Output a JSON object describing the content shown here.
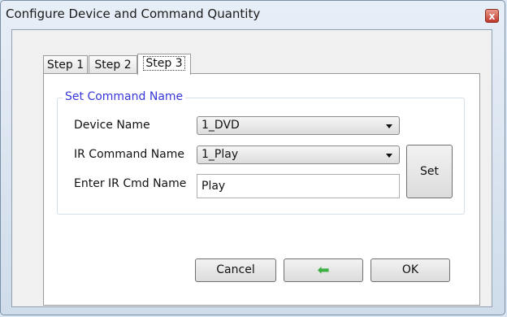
{
  "window": {
    "title": "Configure Device and Command Quantity",
    "close_glyph": "x"
  },
  "tabs": [
    {
      "label": "Step 1",
      "selected": false
    },
    {
      "label": "Step 2",
      "selected": false
    },
    {
      "label": "Step 3",
      "selected": true
    }
  ],
  "group": {
    "title": "Set Command Name",
    "device_name_label": "Device Name",
    "device_name_value": "1_DVD",
    "ir_command_label": "IR Command Name",
    "ir_command_value": "1_Play",
    "enter_cmd_label": "Enter IR Cmd Name",
    "enter_cmd_value": "Play",
    "set_label": "Set"
  },
  "buttons": {
    "cancel": "Cancel",
    "back_icon": "green-left-arrow-icon",
    "ok": "OK"
  },
  "colors": {
    "group_title": "#3737d9",
    "back_arrow": "#3cb043"
  }
}
